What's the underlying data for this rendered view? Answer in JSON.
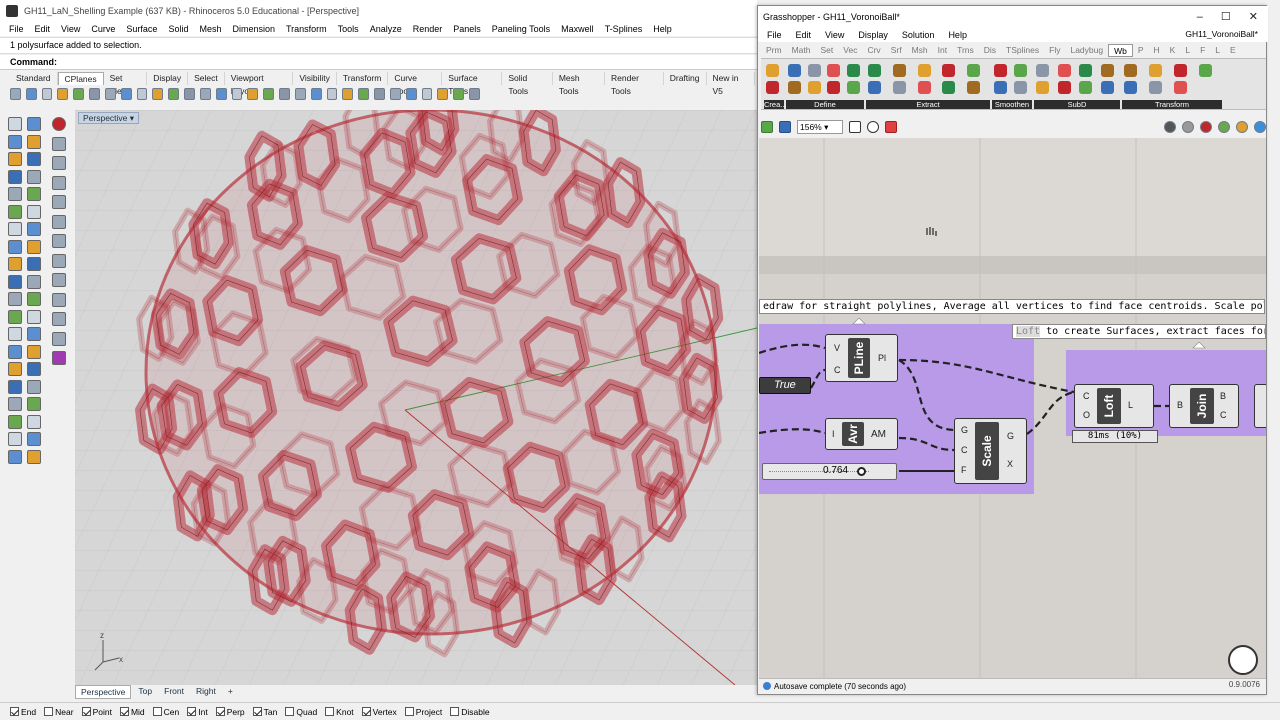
{
  "rhino": {
    "title": "GH11_LaN_Shelling Example (637 KB) - Rhinoceros 5.0 Educational - [Perspective]",
    "menu": [
      "File",
      "Edit",
      "View",
      "Curve",
      "Surface",
      "Solid",
      "Mesh",
      "Dimension",
      "Transform",
      "Tools",
      "Analyze",
      "Render",
      "Panels",
      "Paneling Tools",
      "Maxwell",
      "T-Splines",
      "Help"
    ],
    "command_history": "1 polysurface added to selection.",
    "command_prompt": "Command:",
    "toolbar_tabs": [
      "Standard",
      "CPlanes",
      "Set View",
      "Display",
      "Select",
      "Viewport Layout",
      "Visibility",
      "Transform",
      "Curve Tools",
      "Surface Tools",
      "Solid Tools",
      "Mesh Tools",
      "Render Tools",
      "Drafting",
      "New in V5"
    ],
    "active_toolbar_tab": "CPlanes",
    "viewport_label": "Perspective",
    "viewport_tabs": [
      "Perspective",
      "Top",
      "Front",
      "Right",
      "+"
    ],
    "osnaps": [
      {
        "label": "End",
        "on": true
      },
      {
        "label": "Near",
        "on": false
      },
      {
        "label": "Point",
        "on": true
      },
      {
        "label": "Mid",
        "on": true
      },
      {
        "label": "Cen",
        "on": false
      },
      {
        "label": "Int",
        "on": true
      },
      {
        "label": "Perp",
        "on": true
      },
      {
        "label": "Tan",
        "on": true
      },
      {
        "label": "Quad",
        "on": false
      },
      {
        "label": "Knot",
        "on": false
      },
      {
        "label": "Vertex",
        "on": true
      },
      {
        "label": "Project",
        "on": false
      },
      {
        "label": "Disable",
        "on": false
      }
    ],
    "axis_x": "x",
    "axis_z": "z",
    "colors": {
      "mesh": "#b8323c",
      "viewport_bg": "#d6d6d6"
    }
  },
  "gh": {
    "title": "Grasshopper - GH11_VoronoiBall*",
    "doc_name": "GH11_VoronoiBall*",
    "menu": [
      "File",
      "Edit",
      "View",
      "Display",
      "Solution",
      "Help"
    ],
    "tabs": [
      "Prm",
      "Math",
      "Set",
      "Vec",
      "Crv",
      "Srf",
      "Msh",
      "Int",
      "Trns",
      "Dis",
      "TSplines",
      "Fly",
      "Ladybug",
      "Wb",
      "P",
      "H",
      "K",
      "L",
      "F",
      "L",
      "E"
    ],
    "active_tab": "Wb",
    "ribbon_groups": [
      "Crea...",
      "Define",
      "Extract",
      "Smoothen",
      "SubD",
      "Transform"
    ],
    "zoom": "156%",
    "group1_label": "edraw for straight polylines, Average all vertices to find face centroids. Scale polyline using centroid",
    "group2_label_highlight": "Loft",
    "group2_label_rest": " to create Surfaces, extract faces for Meshing",
    "components": {
      "pline": {
        "name": "PLine",
        "inputs": [
          "V",
          "C"
        ],
        "outputs": [
          "Pl"
        ]
      },
      "avr": {
        "name": "Avr",
        "inputs": [
          "I"
        ],
        "outputs": [
          "AM"
        ]
      },
      "scale": {
        "name": "Scale",
        "inputs": [
          "G",
          "C",
          "F"
        ],
        "outputs": [
          "G",
          "X"
        ]
      },
      "loft": {
        "name": "Loft",
        "inputs": [
          "C",
          "O"
        ],
        "outputs": [
          "L"
        ],
        "profile": "81ms (10%)"
      },
      "join": {
        "name": "Join",
        "inputs": [
          "B"
        ],
        "outputs": [
          "B",
          "C"
        ]
      }
    },
    "toggle_value": "True",
    "slider_value": "0.764",
    "status": "Autosave complete (70 seconds ago)",
    "version": "0.9.0076",
    "colors": {
      "group": "#b89ae8",
      "canvas": "#d5d2cd"
    }
  }
}
